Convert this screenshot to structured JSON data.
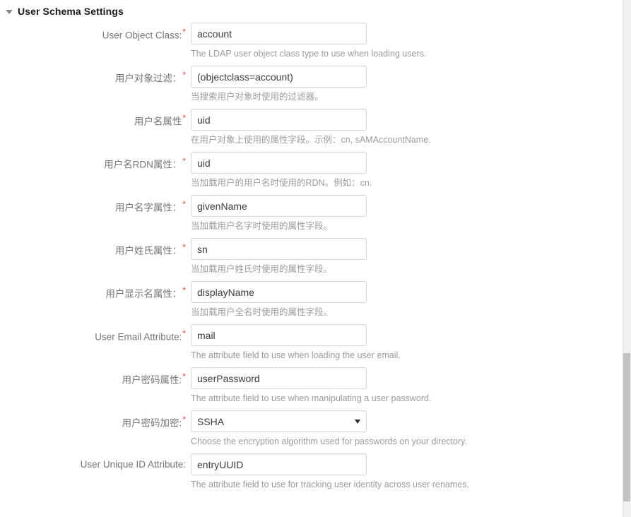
{
  "section": {
    "title": "User Schema Settings",
    "collapse_icon": "caret-down-icon",
    "expanded": true
  },
  "colors": {
    "required_asterisk": "#d94f43",
    "label_text": "#757575",
    "help_text": "#9b9b9b",
    "input_border": "#d5d5d5",
    "input_text": "#3b3b3b",
    "page_background": "#ffffff",
    "scrollbar_track": "#f1f1f1",
    "scrollbar_thumb": "#c2c2c2"
  },
  "fields": [
    {
      "label": "User Object Class:",
      "required": true,
      "type": "text",
      "value": "account",
      "help": "The LDAP user object class type to use when loading users."
    },
    {
      "label": "用户对象过滤：",
      "required": true,
      "type": "text",
      "value": "(objectclass=account)",
      "help": "当搜索用户对象时使用的过滤器。"
    },
    {
      "label": "用户名属性",
      "required": true,
      "type": "text",
      "value": "uid",
      "help": "在用户对象上使用的属性字段。示例：cn, sAMAccountName."
    },
    {
      "label": "用户名RDN属性：",
      "required": true,
      "type": "text",
      "value": "uid",
      "help": "当加载用户的用户名时使用的RDN。例如：cn."
    },
    {
      "label": "用户名字属性：",
      "required": true,
      "type": "text",
      "value": "givenName",
      "help": "当加载用户名字时使用的属性字段。"
    },
    {
      "label": "用户姓氏属性：",
      "required": true,
      "type": "text",
      "value": "sn",
      "help": "当加载用户姓氏时使用的属性字段。"
    },
    {
      "label": "用户显示名属性：",
      "required": true,
      "type": "text",
      "value": "displayName",
      "help": "当加载用户全名时使用的属性字段。"
    },
    {
      "label": "User Email Attribute:",
      "required": true,
      "type": "text",
      "value": "mail",
      "help": "The attribute field to use when loading the user email."
    },
    {
      "label": "用户密码属性:",
      "required": true,
      "type": "text",
      "value": "userPassword",
      "help": "The attribute field to use when manipulating a user password."
    },
    {
      "label": "用户密码加密:",
      "required": true,
      "type": "select",
      "value": "SSHA",
      "dropdown_icon": "caret-down-icon",
      "help": "Choose the encryption algorithm used for passwords on your directory."
    },
    {
      "label": "User Unique ID Attribute:",
      "required": false,
      "type": "text",
      "value": "entryUUID",
      "help": "The attribute field to use for tracking user identity across user renames."
    }
  ]
}
